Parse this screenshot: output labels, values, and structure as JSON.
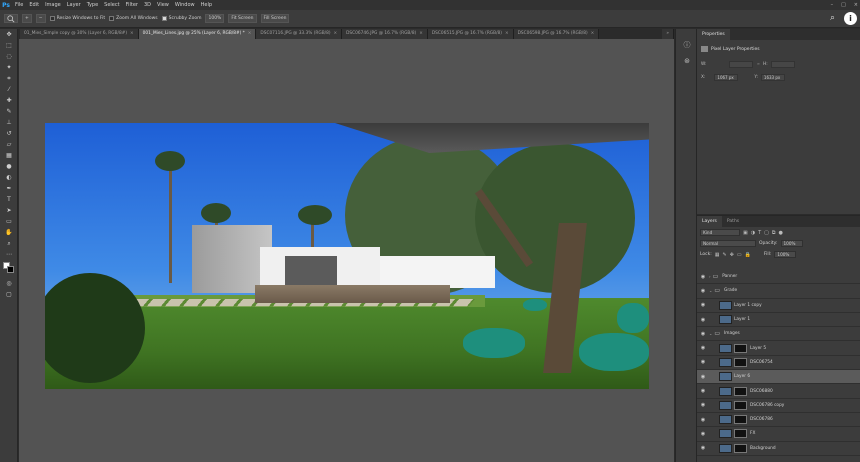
{
  "app": {
    "logo": "Ps",
    "menu": [
      "File",
      "Edit",
      "Image",
      "Layer",
      "Type",
      "Select",
      "Filter",
      "3D",
      "View",
      "Window",
      "Help"
    ],
    "window_controls": [
      "–",
      "□",
      "×"
    ]
  },
  "options": {
    "zoom_in_glyph": "+",
    "zoom_out_glyph": "−",
    "resize_windows_label": "Resize Windows to Fit",
    "zoom_all_windows_label": "Zoom All Windows",
    "scrubby_zoom_label": "Scrubby Zoom",
    "zoom_100_label": "100%",
    "fit_screen_label": "Fit Screen",
    "fill_screen_label": "Fill Screen"
  },
  "tabs": [
    {
      "label": "01_Mies_Simple copy @ 30% (Layer 6, RGB/8#)",
      "active": false
    },
    {
      "label": "001_Mies_Lines.jpg @ 25% (Layer 6, RGB/8#) *",
      "active": true
    },
    {
      "label": "DSC07116.JPG @ 33.3% (RGB/8)",
      "active": false
    },
    {
      "label": "DSC06746.JPG @ 16.7% (RGB/8)",
      "active": false
    },
    {
      "label": "DSC06515.JPG @ 16.7% (RGB/8)",
      "active": false
    },
    {
      "label": "DSC06598.JPG @ 16.7% (RGB/8)",
      "active": false
    }
  ],
  "tab_close_glyph": "×",
  "overflow_glyph": "»",
  "properties": {
    "tabs": [
      "Properties"
    ],
    "title": "Pixel Layer Properties",
    "w_label": "W:",
    "h_label": "H:",
    "x_label": "X:",
    "y_label": "Y:",
    "w_value": "",
    "h_value": "",
    "x_value": "1067 px",
    "y_value": "1633 px"
  },
  "layers_panel": {
    "tabs": [
      "Layers",
      "Paths"
    ],
    "kind_label": "Kind",
    "blend_mode": "Normal",
    "opacity_label": "Opacity:",
    "opacity_value": "100%",
    "lock_label": "Lock:",
    "fill_label": "Fill:",
    "fill_value": "100%",
    "layers": [
      {
        "name": "Panner",
        "type": "folder",
        "indent": 0,
        "selected": false
      },
      {
        "name": "Grade",
        "type": "folder-open",
        "indent": 0,
        "selected": false
      },
      {
        "name": "Layer 1 copy",
        "type": "plain",
        "indent": 1,
        "selected": false
      },
      {
        "name": "Layer 1",
        "type": "plain",
        "indent": 1,
        "selected": false
      },
      {
        "name": "Images",
        "type": "folder-open",
        "indent": 0,
        "selected": false
      },
      {
        "name": "Layer 5",
        "type": "masked",
        "indent": 1,
        "selected": false
      },
      {
        "name": "DSC06754",
        "type": "masked",
        "indent": 1,
        "selected": false
      },
      {
        "name": "Layer 6",
        "type": "plain",
        "indent": 1,
        "selected": true
      },
      {
        "name": "DSC06880",
        "type": "masked",
        "indent": 1,
        "selected": false
      },
      {
        "name": "DSC06786 copy",
        "type": "masked",
        "indent": 1,
        "selected": false
      },
      {
        "name": "DSC06786",
        "type": "masked",
        "indent": 1,
        "selected": false
      },
      {
        "name": "FX",
        "type": "masked",
        "indent": 1,
        "selected": false
      },
      {
        "name": "Background",
        "type": "masked",
        "indent": 1,
        "selected": false
      }
    ]
  },
  "icons": {
    "search": "⌕",
    "info": "i",
    "eye": "◉",
    "folder": "▭"
  }
}
